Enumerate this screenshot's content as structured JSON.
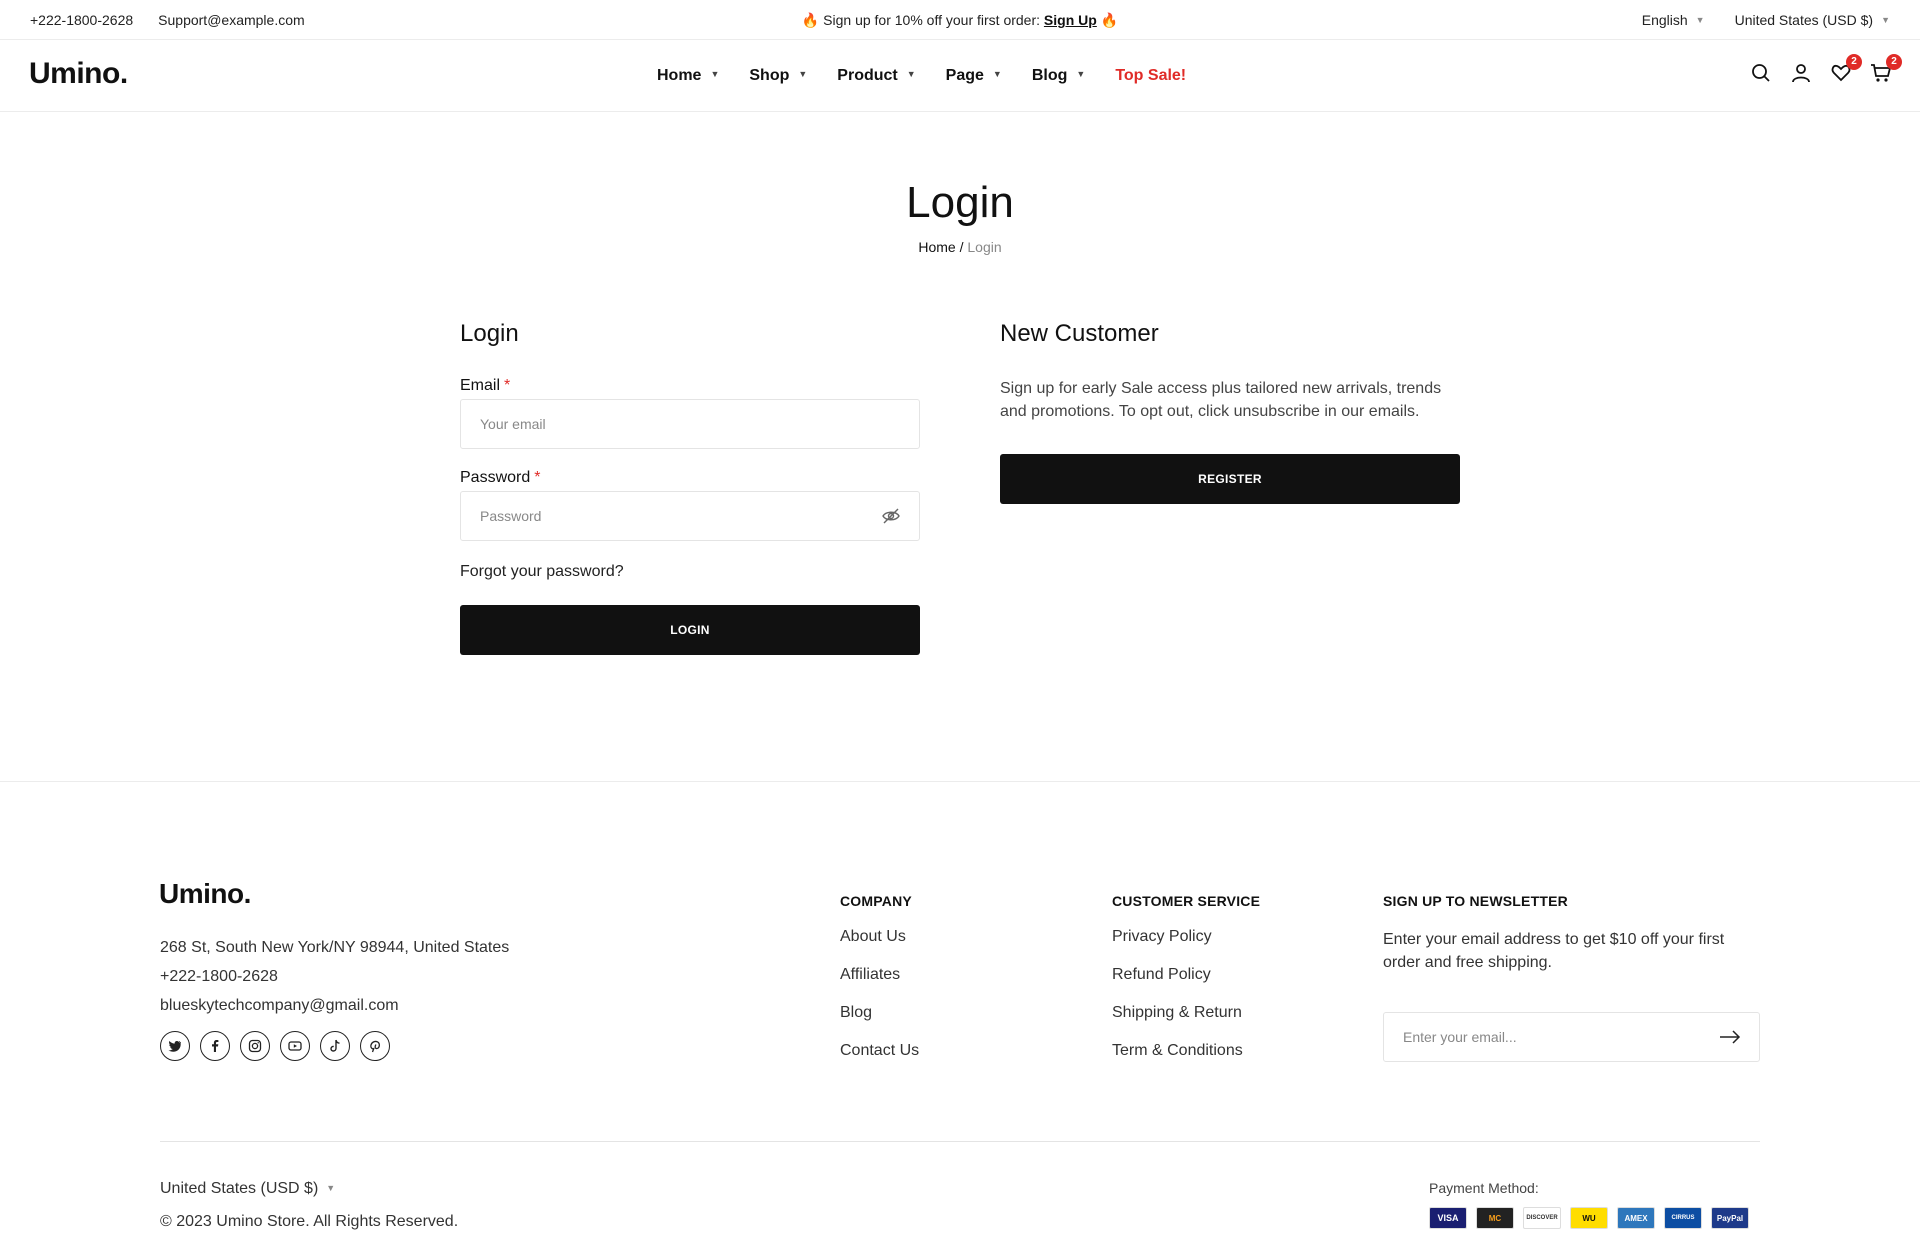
{
  "topbar": {
    "phone": "+222-1800-2628",
    "email": "Support@example.com",
    "promo_text": "Sign up for 10% off your first order:",
    "promo_link": "Sign Up",
    "language": "English",
    "currency": "United States (USD $)"
  },
  "header": {
    "logo": "Umino.",
    "nav": [
      "Home",
      "Shop",
      "Product",
      "Page",
      "Blog"
    ],
    "nav_sale": "Top Sale!",
    "wishlist_count": "2",
    "cart_count": "2"
  },
  "page": {
    "title": "Login",
    "breadcrumb_home": "Home",
    "breadcrumb_sep": " / ",
    "breadcrumb_current": "Login"
  },
  "login": {
    "title": "Login",
    "email_label": "Email",
    "email_placeholder": "Your email",
    "password_label": "Password",
    "password_placeholder": "Password",
    "required_mark": "*",
    "forgot": "Forgot your password?",
    "submit": "LOGIN"
  },
  "new_customer": {
    "title": "New Customer",
    "text": "Sign up for early Sale access plus tailored new arrivals, trends and promotions. To opt out, click unsubscribe in our emails.",
    "register": "REGISTER"
  },
  "footer": {
    "logo": "Umino.",
    "address": "268 St, South New York/NY 98944, United States",
    "phone": "+222-1800-2628",
    "email": "blueskytechcompany@gmail.com",
    "company_title": "COMPANY",
    "company_links": [
      "About Us",
      "Affiliates",
      "Blog",
      "Contact Us"
    ],
    "service_title": "CUSTOMER SERVICE",
    "service_links": [
      "Privacy Policy",
      "Refund Policy",
      "Shipping & Return",
      "Term & Conditions"
    ],
    "newsletter_title": "SIGN UP TO NEWSLETTER",
    "newsletter_text": "Enter your email address to get $10 off your first order and free shipping.",
    "newsletter_placeholder": "Enter your email...",
    "currency": "United States (USD $)",
    "copyright": "© 2023 Umino Store. All Rights Reserved.",
    "payment_label": "Payment Method:",
    "payment_cards": [
      "VISA",
      "MC",
      "DISCOVER",
      "WU",
      "AMEX",
      "CIRRUS",
      "PayPal"
    ]
  },
  "colors": {
    "accent": "#e02b27",
    "button": "#111111"
  }
}
